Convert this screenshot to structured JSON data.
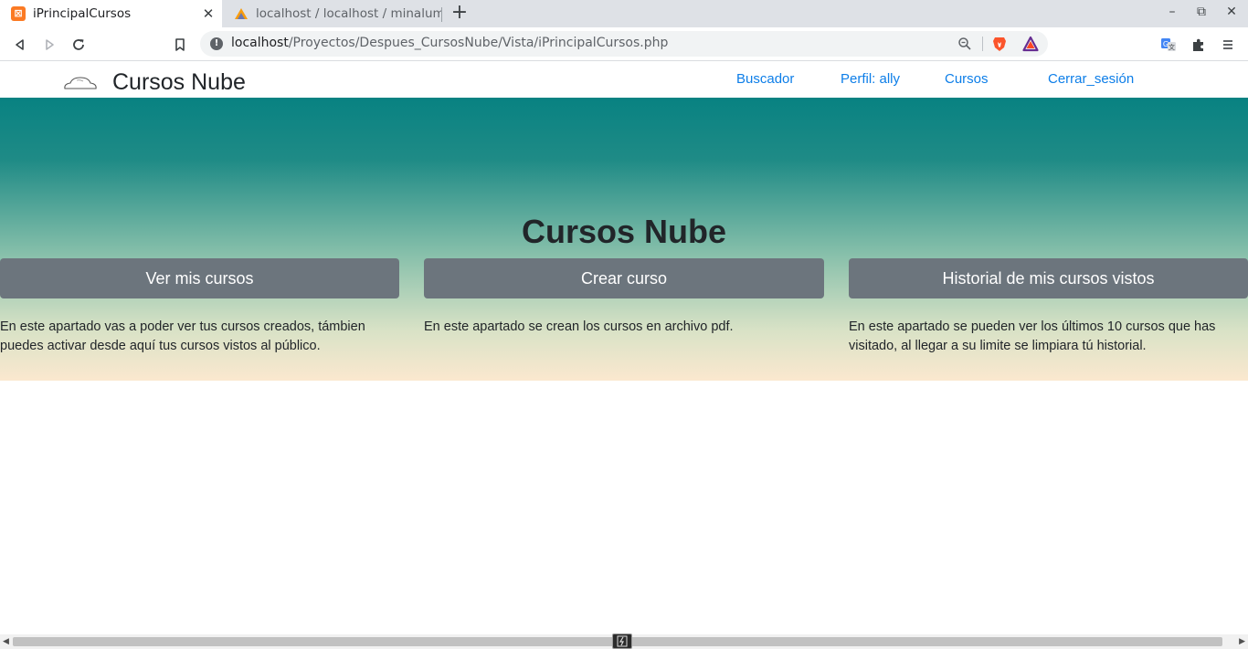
{
  "browser": {
    "tabs": [
      {
        "title": "iPrincipalCursos",
        "favicon": "xampp-icon",
        "active": true
      },
      {
        "title": "localhost / localhost / minalum",
        "favicon": "phpmyadmin-icon",
        "active": false
      }
    ],
    "address": {
      "host": "localhost",
      "path": "/Proyectos/Despues_CursosNube/Vista/iPrincipalCursos.php"
    },
    "icons": [
      "back-icon",
      "forward-icon",
      "reload-icon",
      "bookmark-icon",
      "info-icon",
      "zoom-icon",
      "brave-shield-icon",
      "brave-rewards-icon",
      "translate-icon",
      "extensions-icon",
      "menu-icon",
      "minimize-icon",
      "restore-icon",
      "close-icon"
    ]
  },
  "navbar": {
    "brand": "Cursos Nube",
    "links": [
      "Buscador",
      "Perfil: ally",
      "Cursos",
      "Cerrar_sesión"
    ]
  },
  "hero": {
    "title": "Cursos Nube",
    "cards": [
      {
        "button": "Ver mis cursos",
        "text": "En este apartado vas a poder ver tus cursos creados, támbien puedes activar desde aquí tus cursos vistos al público."
      },
      {
        "button": "Crear curso",
        "text": "En este apartado se crean los cursos en archivo pdf."
      },
      {
        "button": "Historial de mis cursos vistos",
        "text": "En este apartado se pueden ver los últimos 10 cursos que has visitado, al llegar a su limite se limpiara tú historial."
      }
    ]
  },
  "colors": {
    "link": "#0d7ee8",
    "button": "#6c757d",
    "hero_top": "#088282",
    "hero_bottom": "#fbe8cf"
  }
}
